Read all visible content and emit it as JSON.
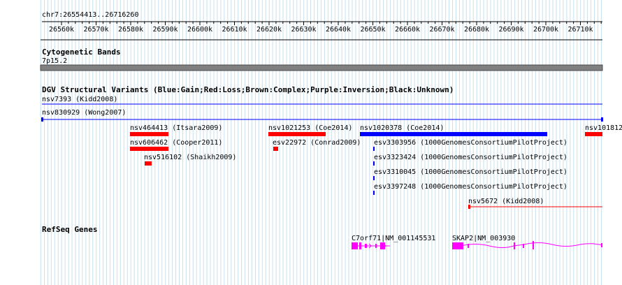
{
  "region": {
    "label": "chr7:26554413..26716260"
  },
  "ruler": {
    "ticks": [
      "26560k",
      "26570k",
      "26580k",
      "26590k",
      "26600k",
      "26610k",
      "26620k",
      "26630k",
      "26640k",
      "26650k",
      "26660k",
      "26670k",
      "26680k",
      "26690k",
      "26700k",
      "26710k"
    ]
  },
  "tracks": {
    "cytoband": {
      "title": "Cytogenetic Bands",
      "band": "7p15.2"
    },
    "dgv": {
      "title": "DGV Structural Variants (Blue:Gain;Red:Loss;Brown:Complex;Purple:Inversion;Black:Unknown)",
      "features": [
        {
          "label": "nsv7393 (Kidd2008)",
          "color": "blue",
          "kind": "line"
        },
        {
          "label": "nsv830929 (Wong2007)",
          "color": "blue",
          "kind": "line"
        },
        {
          "label": "nsv464413 (Itsara2009)",
          "color": "red",
          "kind": "bar"
        },
        {
          "label": "nsv1021253 (Coe2014)",
          "color": "red",
          "kind": "bar"
        },
        {
          "label": "nsv1020378 (Coe2014)",
          "color": "blue",
          "kind": "bar"
        },
        {
          "label": "nsv101812",
          "color": "red",
          "kind": "bar"
        },
        {
          "label": "nsv606462 (Cooper2011)",
          "color": "red",
          "kind": "bar"
        },
        {
          "label": "esv22972 (Conrad2009)",
          "color": "red",
          "kind": "bar"
        },
        {
          "label": "esv3303956 (1000GenomesConsortiumPilotProject)",
          "color": "blue",
          "kind": "tick"
        },
        {
          "label": "nsv516102 (Shaikh2009)",
          "color": "red",
          "kind": "bar"
        },
        {
          "label": "esv3323424 (1000GenomesConsortiumPilotProject)",
          "color": "blue",
          "kind": "tick"
        },
        {
          "label": "esv3310045 (1000GenomesConsortiumPilotProject)",
          "color": "blue",
          "kind": "tick"
        },
        {
          "label": "esv3397248 (1000GenomesConsortiumPilotProject)",
          "color": "blue",
          "kind": "tick"
        },
        {
          "label": "nsv5672 (Kidd2008)",
          "color": "red",
          "kind": "line"
        }
      ]
    },
    "refseq": {
      "title": "RefSeq Genes",
      "genes": [
        {
          "label": "C7orf71|NM_001145531"
        },
        {
          "label": "SKAP2|NM_003930"
        }
      ]
    }
  },
  "colors": {
    "grid": "#c9e0ee",
    "gain": "#0000ff",
    "loss": "#ff0000",
    "gene": "#ff00ff",
    "band": "#808080"
  }
}
